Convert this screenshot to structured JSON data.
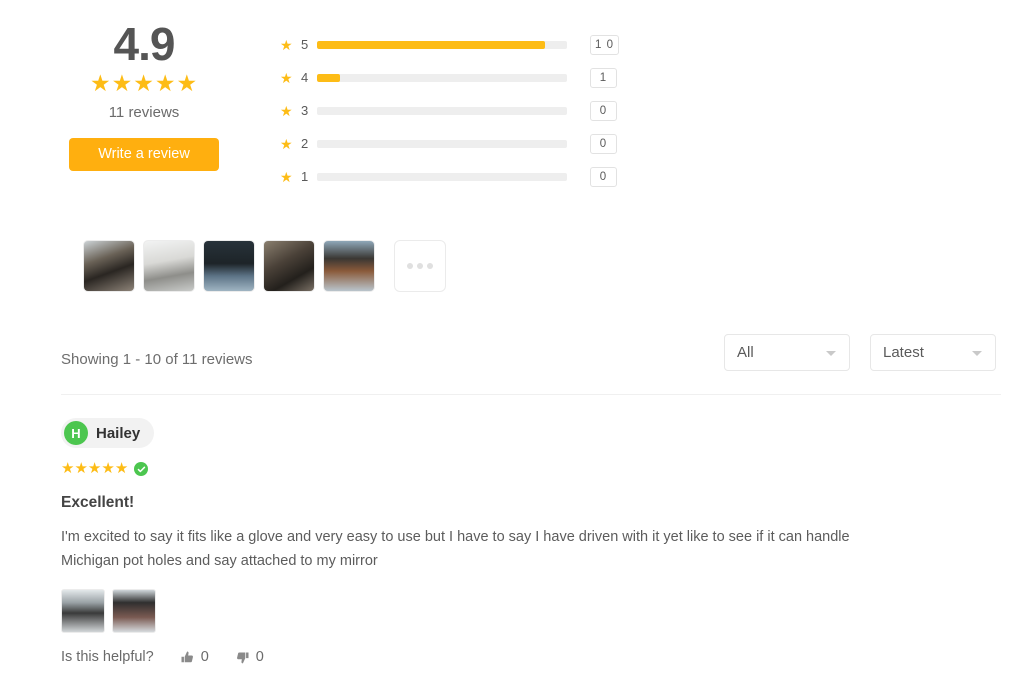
{
  "summary": {
    "score": "4.9",
    "stars_filled": 5,
    "review_count_label": "11 reviews",
    "write_review_label": "Write a review",
    "star_glyph": "★"
  },
  "distribution": {
    "rows": [
      {
        "stars": "5",
        "count": "1 0",
        "percent": 91
      },
      {
        "stars": "4",
        "count": "1",
        "percent": 9
      },
      {
        "stars": "3",
        "count": "0",
        "percent": 0
      },
      {
        "stars": "2",
        "count": "0",
        "percent": 0
      },
      {
        "stars": "1",
        "count": "0",
        "percent": 0
      }
    ]
  },
  "photo_strip": {
    "thumbs": [
      {
        "name": "review-photo-1"
      },
      {
        "name": "review-photo-2"
      },
      {
        "name": "review-photo-3"
      },
      {
        "name": "review-photo-4"
      },
      {
        "name": "review-photo-5"
      }
    ],
    "more_label": "more-photos"
  },
  "toolbar": {
    "showing_label": "Showing 1 - 10 of 11 reviews",
    "filter_value": "All",
    "sort_value": "Latest"
  },
  "review": {
    "author_initial": "H",
    "author_name": "Hailey",
    "rating": 5,
    "verified": true,
    "title": "Excellent!",
    "body": "I'm excited to say it fits like a glove and very easy to use but I have to say I have driven with it yet like to see if it can handle Michigan pot holes and say attached to my mirror",
    "helpful_label": "Is this helpful?",
    "helpful_up_count": "0",
    "helpful_down_count": "0"
  },
  "colors": {
    "accent": "#FDBC16",
    "button": "#FFAF0F",
    "verified_green": "#4CC64F",
    "track": "#eeeeee"
  }
}
